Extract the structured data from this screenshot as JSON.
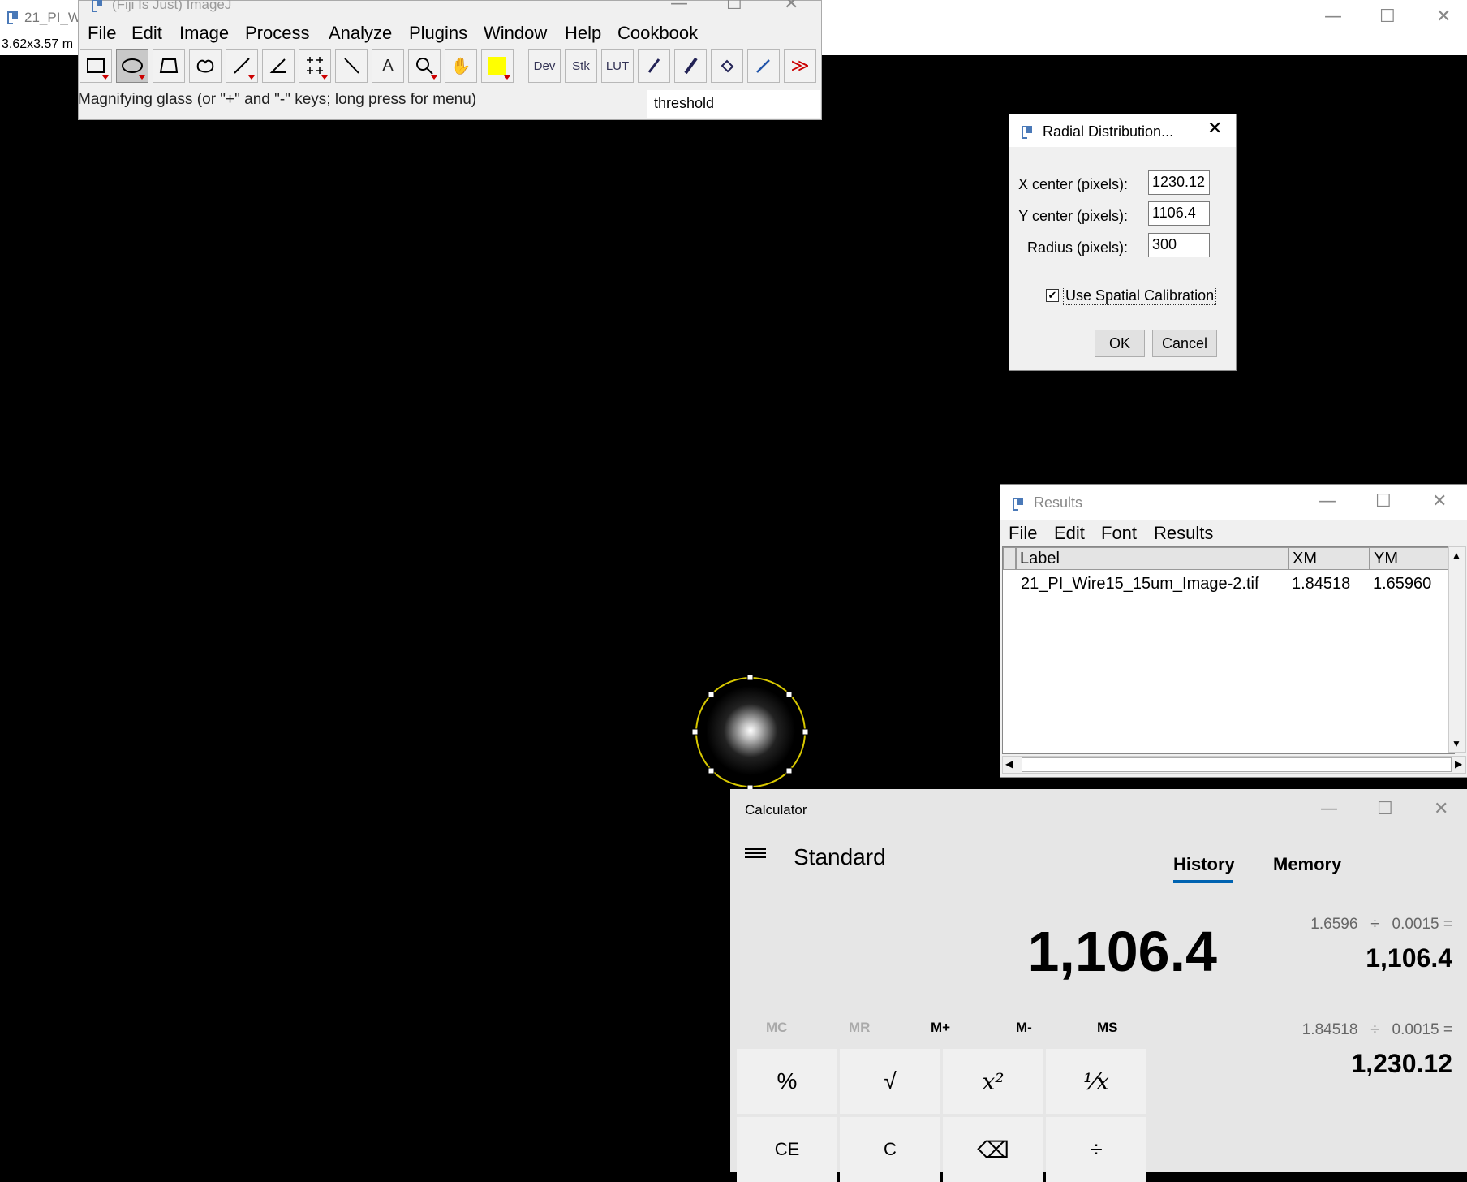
{
  "image_window": {
    "title": "21_PI_W",
    "info": "3.62x3.57 m"
  },
  "imagej": {
    "title": "(Fiji Is Just) ImageJ",
    "menus": [
      "File",
      "Edit",
      "Image",
      "Process",
      "Analyze",
      "Plugins",
      "Window",
      "Help",
      "Cookbook"
    ],
    "tools": [
      "rectangle",
      "oval",
      "polygon",
      "freehand",
      "line",
      "angle",
      "multipoint",
      "wand",
      "text",
      "zoom",
      "hand",
      "color-picker",
      "Dev",
      "Stk",
      "LUT",
      "pencil",
      "brush",
      "flood-fill",
      "picker",
      "more"
    ],
    "status": "Magnifying glass (or \"+\" and \"-\" keys; long press for menu)",
    "search": "threshold"
  },
  "radial_dialog": {
    "title": "Radial Distribution...",
    "x_label": "X center (pixels):",
    "x_value": "1230.12",
    "y_label": "Y center (pixels):",
    "y_value": "1106.4",
    "r_label": "Radius (pixels):",
    "r_value": "300",
    "checkbox_label": "Use Spatial Calibration",
    "checkbox_checked": true,
    "ok": "OK",
    "cancel": "Cancel"
  },
  "results": {
    "title": "Results",
    "menus": [
      "File",
      "Edit",
      "Font",
      "Results"
    ],
    "headers": [
      "Label",
      "XM",
      "YM"
    ],
    "rows": [
      [
        "21_PI_Wire15_15um_Image-2.tif",
        "1.84518",
        "1.65960"
      ]
    ]
  },
  "calculator": {
    "title": "Calculator",
    "mode": "Standard",
    "tab_history": "History",
    "tab_memory": "Memory",
    "display": "1,106.4",
    "memory_buttons": [
      "MC",
      "MR",
      "M+",
      "M-",
      "MS"
    ],
    "keys_row1": [
      "%",
      "√",
      "x²",
      "¹⁄x"
    ],
    "keys_row2": [
      "CE",
      "C",
      "⌫",
      "÷"
    ],
    "history": [
      {
        "expr": "1.6596   ÷   0.0015 =",
        "result": "1,106.4"
      },
      {
        "expr": "1.84518   ÷   0.0015 =",
        "result": "1,230.12"
      }
    ]
  }
}
